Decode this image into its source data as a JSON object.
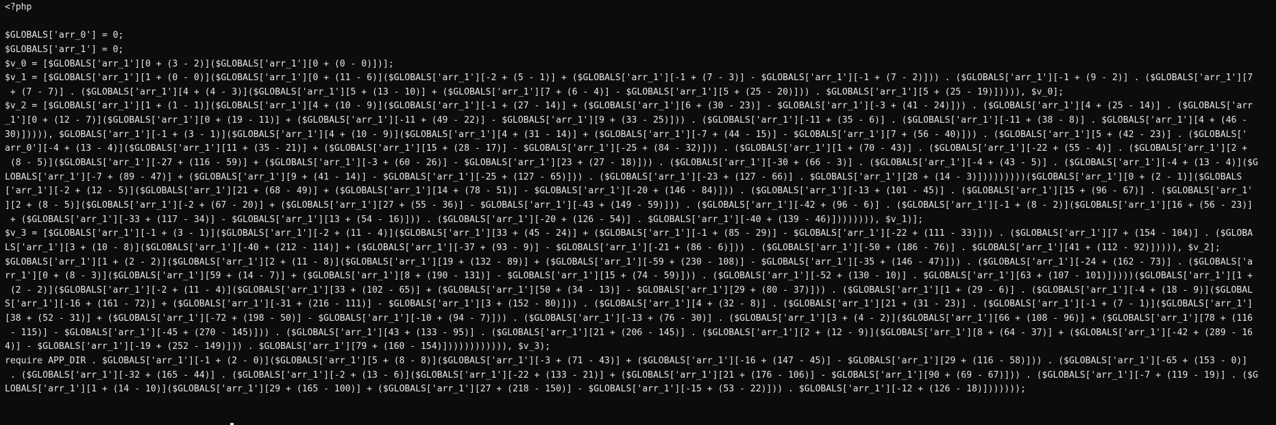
{
  "terminal": {
    "lines": [
      "<?php",
      "",
      "$GLOBALS['arr_0'] = 0;",
      "$GLOBALS['arr_1'] = 0;",
      "$v_0 = [$GLOBALS['arr_1'][0 + (3 - 2)]($GLOBALS['arr_1'][0 + (0 - 0)])];",
      "$v_1 = [$GLOBALS['arr_1'][1 + (0 - 0)]($GLOBALS['arr_1'][0 + (11 - 6)]($GLOBALS['arr_1'][-2 + (5 - 1)] + ($GLOBALS['arr_1'][-1 + (7 - 3)] - $GLOBALS['arr_1'][-1 + (7 - 2)])) . ($GLOBALS['arr_1'][-1 + (9 - 2)] . ($GLOBALS['arr_1'][7",
      " + (7 - 7)] . ($GLOBALS['arr_1'][4 + (4 - 3)]($GLOBALS['arr_1'][5 + (13 - 10)] + ($GLOBALS['arr_1'][7 + (6 - 4)] - $GLOBALS['arr_1'][5 + (25 - 20)])) . $GLOBALS['arr_1'][5 + (25 - 19)])))), $v_0];",
      "$v_2 = [$GLOBALS['arr_1'][1 + (1 - 1)]($GLOBALS['arr_1'][4 + (10 - 9)]($GLOBALS['arr_1'][-1 + (27 - 14)] + ($GLOBALS['arr_1'][6 + (30 - 23)] - $GLOBALS['arr_1'][-3 + (41 - 24)])) . ($GLOBALS['arr_1'][4 + (25 - 14)] . ($GLOBALS['arr",
      "_1'][0 + (12 - 7)]($GLOBALS['arr_1'][0 + (19 - 11)] + ($GLOBALS['arr_1'][-11 + (49 - 22)] - $GLOBALS['arr_1'][9 + (33 - 25)])) . ($GLOBALS['arr_1'][-11 + (35 - 6)] . ($GLOBALS['arr_1'][-11 + (38 - 8)] . $GLOBALS['arr_1'][4 + (46 -",
      "30)])))), $GLOBALS['arr_1'][-1 + (3 - 1)]($GLOBALS['arr_1'][4 + (10 - 9)]($GLOBALS['arr_1'][4 + (31 - 14)] + ($GLOBALS['arr_1'][-7 + (44 - 15)] - $GLOBALS['arr_1'][7 + (56 - 40)])) . ($GLOBALS['arr_1'][5 + (42 - 23)] . ($GLOBALS['",
      "arr_0'][-4 + (13 - 4)]($GLOBALS['arr_1'][11 + (35 - 21)] + ($GLOBALS['arr_1'][15 + (28 - 17)] - $GLOBALS['arr_1'][-25 + (84 - 32)])) . ($GLOBALS['arr_1'][1 + (70 - 43)] . ($GLOBALS['arr_1'][-22 + (55 - 4)] . ($GLOBALS['arr_1'][2 +",
      " (8 - 5)]($GLOBALS['arr_1'][-27 + (116 - 59)] + ($GLOBALS['arr_1'][-3 + (60 - 26)] - $GLOBALS['arr_1'][23 + (27 - 18)])) . ($GLOBALS['arr_1'][-30 + (66 - 3)] . ($GLOBALS['arr_1'][-4 + (43 - 5)] . ($GLOBALS['arr_1'][-4 + (13 - 4)]($G",
      "LOBALS['arr_1'][-7 + (89 - 47)] + ($GLOBALS['arr_1'][9 + (41 - 14)] - $GLOBALS['arr_1'][-25 + (127 - 65)])) . ($GLOBALS['arr_1'][-23 + (127 - 66)] . $GLOBALS['arr_1'][28 + (14 - 3)]))))))))($GLOBALS['arr_1'][0 + (2 - 1)]($GLOBALS",
      "['arr_1'][-2 + (12 - 5)]($GLOBALS['arr_1'][21 + (68 - 49)] + ($GLOBALS['arr_1'][14 + (78 - 51)] - $GLOBALS['arr_1'][-20 + (146 - 84)])) . ($GLOBALS['arr_1'][-13 + (101 - 45)] . ($GLOBALS['arr_1'][15 + (96 - 67)] . ($GLOBALS['arr_1'",
      "][2 + (8 - 5)]($GLOBALS['arr_1'][-2 + (67 - 20)] + ($GLOBALS['arr_1'][27 + (55 - 36)] - $GLOBALS['arr_1'][-43 + (149 - 59)])) . ($GLOBALS['arr_1'][-42 + (96 - 6)] . ($GLOBALS['arr_1'][-1 + (8 - 2)]($GLOBALS['arr_1'][16 + (56 - 23)]",
      " + ($GLOBALS['arr_1'][-33 + (117 - 34)] - $GLOBALS['arr_1'][13 + (54 - 16)])) . ($GLOBALS['arr_1'][-20 + (126 - 54)] . $GLOBALS['arr_1'][-40 + (139 - 46)]))))))), $v_1)];",
      "$v_3 = [$GLOBALS['arr_1'][-1 + (3 - 1)]($GLOBALS['arr_1'][-2 + (11 - 4)]($GLOBALS['arr_1'][33 + (45 - 24)] + ($GLOBALS['arr_1'][-1 + (85 - 29)] - $GLOBALS['arr_1'][-22 + (111 - 33)])) . ($GLOBALS['arr_1'][7 + (154 - 104)] . ($GLOBA",
      "LS['arr_1'][3 + (10 - 8)]($GLOBALS['arr_1'][-40 + (212 - 114)] + ($GLOBALS['arr_1'][-37 + (93 - 9)] - $GLOBALS['arr_1'][-21 + (86 - 6)])) . ($GLOBALS['arr_1'][-50 + (186 - 76)] . $GLOBALS['arr_1'][41 + (112 - 92)])))), $v_2];",
      "$GLOBALS['arr_1'][1 + (2 - 2)]($GLOBALS['arr_1'][2 + (11 - 8)]($GLOBALS['arr_1'][19 + (132 - 89)] + ($GLOBALS['arr_1'][-59 + (230 - 108)] - $GLOBALS['arr_1'][-35 + (146 - 47)])) . ($GLOBALS['arr_1'][-24 + (162 - 73)] . ($GLOBALS['a",
      "rr_1'][0 + (8 - 3)]($GLOBALS['arr_1'][59 + (14 - 7)] + ($GLOBALS['arr_1'][8 + (190 - 131)] - $GLOBALS['arr_1'][15 + (74 - 59)])) . ($GLOBALS['arr_1'][-52 + (130 - 10)] . $GLOBALS['arr_1'][63 + (107 - 101)]))))($GLOBALS['arr_1'][1 +",
      " (2 - 2)]($GLOBALS['arr_1'][-2 + (11 - 4)]($GLOBALS['arr_1'][33 + (102 - 65)] + ($GLOBALS['arr_1'][50 + (34 - 13)] - $GLOBALS['arr_1'][29 + (80 - 37)])) . ($GLOBALS['arr_1'][1 + (29 - 6)] . ($GLOBALS['arr_1'][-4 + (18 - 9)]($GLOBAL",
      "S['arr_1'][-16 + (161 - 72)] + ($GLOBALS['arr_1'][-31 + (216 - 111)] - $GLOBALS['arr_1'][3 + (152 - 80)])) . ($GLOBALS['arr_1'][4 + (32 - 8)] . ($GLOBALS['arr_1'][21 + (31 - 23)] . ($GLOBALS['arr_1'][-1 + (7 - 1)]($GLOBALS['arr_1']",
      "[38 + (52 - 31)] + ($GLOBALS['arr_1'][-72 + (198 - 50)] - $GLOBALS['arr_1'][-10 + (94 - 7)])) . ($GLOBALS['arr_1'][-13 + (76 - 30)] . ($GLOBALS['arr_1'][3 + (4 - 2)]($GLOBALS['arr_1'][66 + (108 - 96)] + ($GLOBALS['arr_1'][78 + (116",
      " - 115)] - $GLOBALS['arr_1'][-45 + (270 - 145)])) . ($GLOBALS['arr_1'][43 + (133 - 95)] . ($GLOBALS['arr_1'][21 + (206 - 145)] . ($GLOBALS['arr_1'][2 + (12 - 9)]($GLOBALS['arr_1'][8 + (64 - 37)] + ($GLOBALS['arr_1'][-42 + (289 - 16",
      "4)] - $GLOBALS['arr_1'][-19 + (252 - 149)])) . $GLOBALS['arr_1'][79 + (160 - 154)]))))))))))), $v_3);",
      "require APP_DIR . $GLOBALS['arr_1'][-1 + (2 - 0)]($GLOBALS['arr_1'][5 + (8 - 8)]($GLOBALS['arr_1'][-3 + (71 - 43)] + ($GLOBALS['arr_1'][-16 + (147 - 45)] - $GLOBALS['arr_1'][29 + (116 - 58)])) . ($GLOBALS['arr_1'][-65 + (153 - 0)]",
      " . ($GLOBALS['arr_1'][-32 + (165 - 44)] . ($GLOBALS['arr_1'][-2 + (13 - 6)]($GLOBALS['arr_1'][-22 + (133 - 21)] + ($GLOBALS['arr_1'][21 + (176 - 106)] - $GLOBALS['arr_1'][90 + (69 - 67)])) . ($GLOBALS['arr_1'][-7 + (119 - 19)] . ($G",
      "LOBALS['arr_1'][1 + (14 - 10)]($GLOBALS['arr_1'][29 + (165 - 100)] + ($GLOBALS['arr_1'][27 + (218 - 150)] - $GLOBALS['arr_1'][-15 + (53 - 22)])) . $GLOBALS['arr_1'][-12 + (126 - 18)]))))));"
    ]
  }
}
